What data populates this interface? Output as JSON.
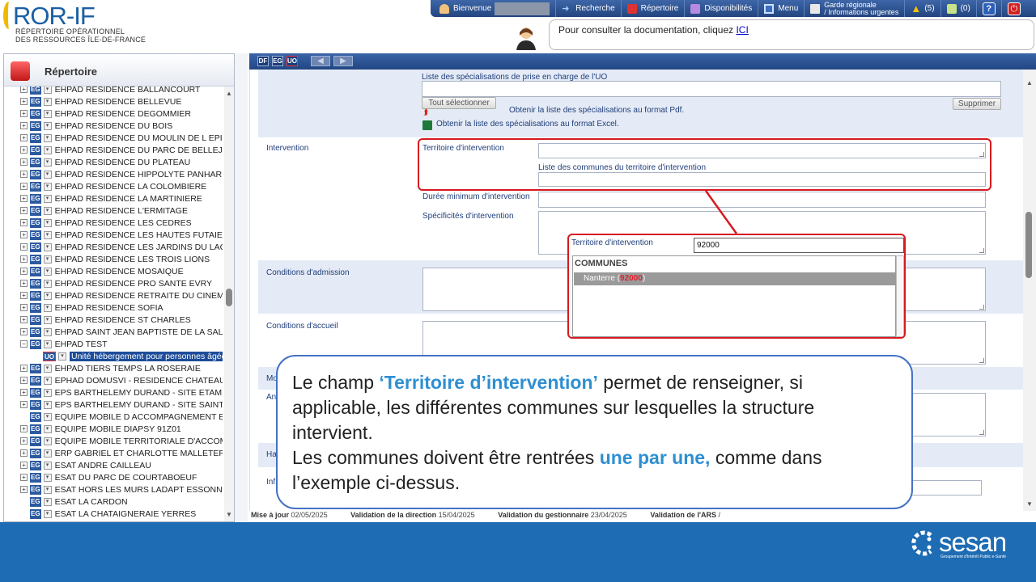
{
  "header": {
    "logo_title": "ROR-IF",
    "logo_sub1": "RÉPERTOIRE OPÉRATIONNEL",
    "logo_sub2": "DES RESSOURCES ÎLE-DE-FRANCE",
    "nav": {
      "welcome": "Bienvenue",
      "search": "Recherche",
      "directory": "Répertoire",
      "availability": "Disponibilités",
      "menu": "Menu",
      "guard_line1": "Garde régionale",
      "guard_line2": "/ Informations urgentes",
      "alerts": "(5)",
      "messages": "(0)",
      "help": "?"
    },
    "doc_text": "Pour consulter la documentation, cliquez ",
    "doc_link": "ICI"
  },
  "sidebar": {
    "title": "Répertoire",
    "items": [
      {
        "label": "EHPAD RESIDENCE BALLANCOURT"
      },
      {
        "label": "EHPAD RESIDENCE BELLEVUE"
      },
      {
        "label": "EHPAD RESIDENCE DEGOMMIER"
      },
      {
        "label": "EHPAD RESIDENCE DU BOIS"
      },
      {
        "label": "EHPAD RESIDENCE DU MOULIN DE L EPIN"
      },
      {
        "label": "EHPAD RESIDENCE DU PARC DE BELLEJA"
      },
      {
        "label": "EHPAD RESIDENCE DU PLATEAU"
      },
      {
        "label": "EHPAD RESIDENCE HIPPOLYTE PANHARD"
      },
      {
        "label": "EHPAD RESIDENCE LA COLOMBIERE"
      },
      {
        "label": "EHPAD RESIDENCE LA MARTINIERE"
      },
      {
        "label": "EHPAD RESIDENCE L'ERMITAGE"
      },
      {
        "label": "EHPAD RESIDENCE LES CEDRES"
      },
      {
        "label": "EHPAD RESIDENCE LES HAUTES FUTAIES"
      },
      {
        "label": "EHPAD RESIDENCE LES JARDINS DU LAC"
      },
      {
        "label": "EHPAD RESIDENCE LES TROIS LIONS"
      },
      {
        "label": "EHPAD RESIDENCE MOSAIQUE"
      },
      {
        "label": "EHPAD RESIDENCE PRO SANTE EVRY"
      },
      {
        "label": "EHPAD RESIDENCE RETRAITE DU CINEMA"
      },
      {
        "label": "EHPAD RESIDENCE SOFIA"
      },
      {
        "label": "EHPAD RESIDENCE ST CHARLES"
      },
      {
        "label": "EHPAD SAINT JEAN BAPTISTE DE LA SALL"
      },
      {
        "label": "EHPAD TEST"
      },
      {
        "label": "Unité hébergement pour personnes âgées"
      },
      {
        "label": "EHPAD TIERS TEMPS LA ROSERAIE"
      },
      {
        "label": "EPHAD DOMUSVI - RESIDENCE CHATEAU"
      },
      {
        "label": "EPS BARTHELEMY DURAND - SITE ETAMP"
      },
      {
        "label": "EPS BARTHELEMY DURAND - SITE SAINTE"
      },
      {
        "label": "EQUIPE MOBILE D ACCOMPAGNEMENT EN"
      },
      {
        "label": "EQUIPE MOBILE DIAPSY 91Z01"
      },
      {
        "label": "EQUIPE MOBILE TERRITORIALE D'ACCOM"
      },
      {
        "label": "ERP GABRIEL ET CHARLOTTE MALLETERI"
      },
      {
        "label": "ESAT ANDRE CAILLEAU"
      },
      {
        "label": "ESAT DU PARC DE COURTABOEUF"
      },
      {
        "label": "ESAT HORS LES MURS LADAPT ESSONNE"
      },
      {
        "label": "ESAT LA CARDON"
      },
      {
        "label": "ESAT LA CHATAIGNERAIE YERRES"
      }
    ],
    "badge_eg": "EG",
    "badge_uo": "UO"
  },
  "toolbar": {
    "df": "DF",
    "eg": "EG",
    "uo": "UO"
  },
  "form": {
    "spec_title": "Liste des spécialisations de prise en charge de l'UO",
    "select_all": "Tout sélectionner",
    "delete": "Supprimer",
    "pdf_link": "Obtenir la liste des spécialisations au format Pdf.",
    "excel_link": "Obtenir la liste des spécialisations au format Excel.",
    "intervention": "Intervention",
    "territory": "Territoire d'intervention",
    "communes_list": "Liste des communes du territoire d'intervention",
    "min_duration": "Durée minimum d'intervention",
    "specifics": "Spécificités d'intervention",
    "admission": "Conditions d'admission",
    "reception": "Conditions d'accueil",
    "trunc_mo": "Mo",
    "trunc_an": "An",
    "trunc_ha": "Ha",
    "trunc_inf": "Inf"
  },
  "zoom": {
    "label": "Territoire d'intervention",
    "input_value": "92000",
    "list_header": "COMMUNES",
    "item_name": "Nanterre (",
    "item_code": "92000",
    "item_close": ")"
  },
  "meta": {
    "updated_label": "Mise à jour",
    "updated": "02/05/2025",
    "direction_label": "Validation de la direction",
    "direction": "15/04/2025",
    "manager_label": "Validation du gestionnaire",
    "manager": "23/04/2025",
    "ars_label": "Validation de l'ARS",
    "ars": "/"
  },
  "callout": {
    "p1a": "Le champ ",
    "p1b": "‘Territoire d’intervention’",
    "p1c": " permet de renseigner, si applicable, les différentes communes sur lesquelles la structure intervient.",
    "p2a": "Les communes doivent être rentrées ",
    "p2b": "une par une,",
    "p2c": " comme dans l’exemple ci-dessus."
  },
  "brand": {
    "name": "sesan",
    "tagline": "Groupement d'Intérêt Public e-Santé"
  },
  "colors": {
    "accent_blue": "#1e6cb3",
    "annotation_red": "#d71920",
    "highlight_blue": "#2e8fd1"
  }
}
